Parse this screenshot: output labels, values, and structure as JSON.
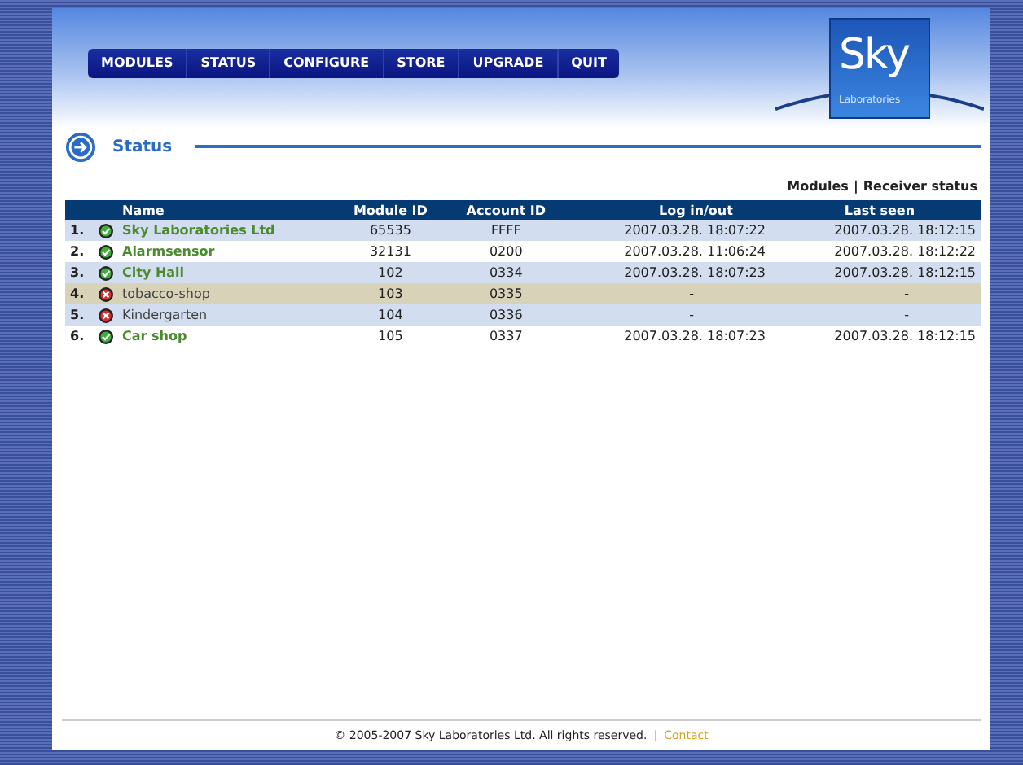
{
  "nav": [
    "MODULES",
    "STATUS",
    "CONFIGURE",
    "STORE",
    "UPGRADE",
    "QUIT"
  ],
  "logo": {
    "title": "Sky",
    "subtitle": "Laboratories"
  },
  "page_title": "Status",
  "links": {
    "items": [
      "Modules",
      "Receiver status"
    ],
    "separator": "|"
  },
  "table": {
    "columns": [
      "Name",
      "Module ID",
      "Account ID",
      "Log in/out",
      "Last seen"
    ],
    "rows": [
      {
        "index": "1.",
        "online": true,
        "selected": false,
        "name": "Sky Laboratories Ltd",
        "module_id": "65535",
        "account_id": "FFFF",
        "log": "2007.03.28. 18:07:22",
        "last_seen": "2007.03.28. 18:12:15"
      },
      {
        "index": "2.",
        "online": true,
        "selected": false,
        "name": "Alarmsensor",
        "module_id": "32131",
        "account_id": "0200",
        "log": "2007.03.28. 11:06:24",
        "last_seen": "2007.03.28. 18:12:22"
      },
      {
        "index": "3.",
        "online": true,
        "selected": false,
        "name": "City Hall",
        "module_id": "102",
        "account_id": "0334",
        "log": "2007.03.28. 18:07:23",
        "last_seen": "2007.03.28. 18:12:15"
      },
      {
        "index": "4.",
        "online": false,
        "selected": true,
        "name": "tobacco-shop",
        "module_id": "103",
        "account_id": "0335",
        "log": "-",
        "last_seen": "-"
      },
      {
        "index": "5.",
        "online": false,
        "selected": false,
        "name": "Kindergarten",
        "module_id": "104",
        "account_id": "0336",
        "log": "-",
        "last_seen": "-"
      },
      {
        "index": "6.",
        "online": true,
        "selected": false,
        "name": "Car shop",
        "module_id": "105",
        "account_id": "0337",
        "log": "2007.03.28. 18:07:23",
        "last_seen": "2007.03.28. 18:12:15"
      }
    ]
  },
  "footer": {
    "copyright": "© 2005-2007 Sky Laboratories Ltd. All rights reserved.",
    "separator": "|",
    "link": "Contact"
  }
}
